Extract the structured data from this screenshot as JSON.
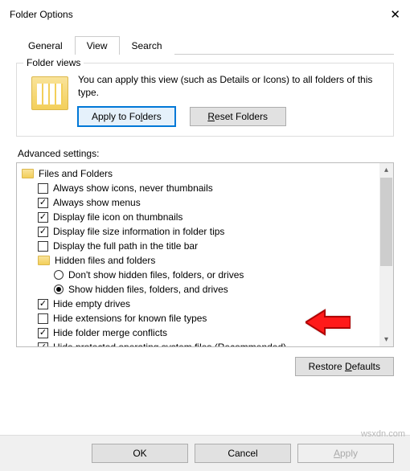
{
  "window": {
    "title": "Folder Options"
  },
  "tabs": {
    "general": "General",
    "view": "View",
    "search": "Search",
    "active": "View"
  },
  "folder_views": {
    "group_label": "Folder views",
    "description": "You can apply this view (such as Details or Icons) to all folders of this type.",
    "apply_btn": "Apply to Folders",
    "reset_btn": "Reset Folders"
  },
  "advanced": {
    "label": "Advanced settings:",
    "root": "Files and Folders",
    "items": [
      {
        "type": "check",
        "checked": false,
        "label": "Always show icons, never thumbnails"
      },
      {
        "type": "check",
        "checked": true,
        "label": "Always show menus"
      },
      {
        "type": "check",
        "checked": true,
        "label": "Display file icon on thumbnails"
      },
      {
        "type": "check",
        "checked": true,
        "label": "Display file size information in folder tips"
      },
      {
        "type": "check",
        "checked": false,
        "label": "Display the full path in the title bar"
      },
      {
        "type": "folder",
        "label": "Hidden files and folders"
      },
      {
        "type": "radio",
        "selected": false,
        "label": "Don't show hidden files, folders, or drives"
      },
      {
        "type": "radio",
        "selected": true,
        "label": "Show hidden files, folders, and drives"
      },
      {
        "type": "check",
        "checked": true,
        "label": "Hide empty drives"
      },
      {
        "type": "check",
        "checked": false,
        "label": "Hide extensions for known file types"
      },
      {
        "type": "check",
        "checked": true,
        "label": "Hide folder merge conflicts"
      },
      {
        "type": "check",
        "checked": true,
        "label": "Hide protected operating system files (Recommended)"
      }
    ],
    "restore_btn": "Restore Defaults"
  },
  "footer": {
    "ok": "OK",
    "cancel": "Cancel",
    "apply": "Apply"
  },
  "watermark": "wsxdn.com"
}
